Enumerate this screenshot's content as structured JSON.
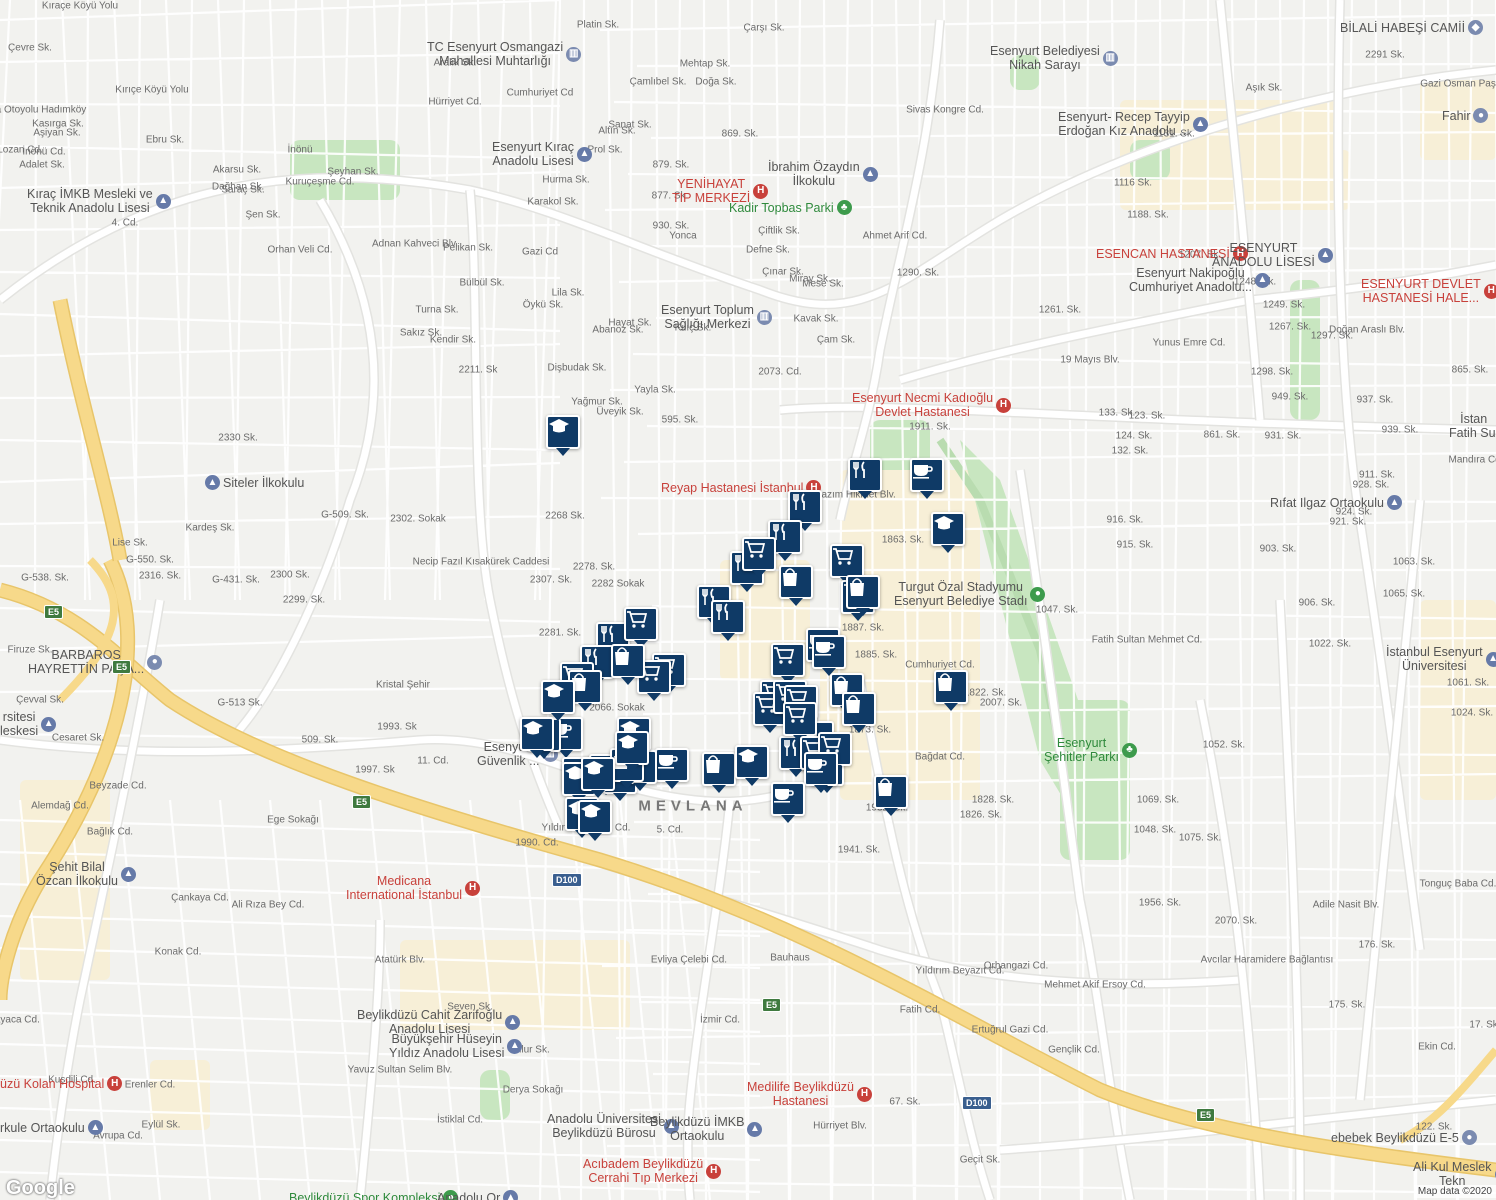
{
  "map": {
    "attribution": "Map data ©2020",
    "logo": "Google",
    "district_label": "MEVLANA",
    "colors": {
      "background": "#f2f2ef",
      "street": "#ffffff",
      "highway": "#f7d98a",
      "park": "#c8e6c0",
      "commercial": "#f7efd7",
      "pin": "#0f3a66",
      "hospital": "#c8413b",
      "school": "#667aa8",
      "park_label": "#2f8a3c"
    },
    "road_shields": [
      {
        "text": "E5",
        "type": "green"
      },
      {
        "text": "E5",
        "type": "green"
      },
      {
        "text": "E5",
        "type": "green"
      },
      {
        "text": "E5",
        "type": "green"
      },
      {
        "text": "E5",
        "type": "green"
      },
      {
        "text": "D100",
        "type": "blue"
      },
      {
        "text": "D100",
        "type": "blue"
      }
    ],
    "pois": [
      {
        "name": "TC Esenyurt Osmangazi\nMahallesi Muhtarlığı",
        "type": "gov",
        "icon": "government-icon"
      },
      {
        "name": "Esenyurt Belediyesi\nNikah Sarayı",
        "type": "gov",
        "icon": "government-icon"
      },
      {
        "name": "BİLALİ HABEŞİ CAMİİ",
        "type": "gov",
        "icon": "mosque-icon"
      },
      {
        "name": "Esenyurt Kıraç\nAnadolu Lisesi",
        "type": "school",
        "icon": "school-icon"
      },
      {
        "name": "Esenyurt- Recep Tayyip\nErdoğan Kız Anadolu ...",
        "type": "school",
        "icon": "school-icon"
      },
      {
        "name": "Kıraç İMKB Mesleki ve\nTeknik Anadolu Lisesi",
        "type": "school",
        "icon": "school-icon"
      },
      {
        "name": "YENİHAYAT\nTIP MERKEZİ",
        "type": "hospital",
        "icon": "hospital-icon"
      },
      {
        "name": "İbrahim Özaydın\nİlkokulu",
        "type": "school",
        "icon": "school-icon"
      },
      {
        "name": "Kadir Topbas Parki",
        "type": "park",
        "icon": "tree-icon"
      },
      {
        "name": "ESENCAN HASTANESİ",
        "type": "hospital",
        "icon": "hospital-icon"
      },
      {
        "name": "ESENYURT\nANADOLU LİSESİ",
        "type": "school",
        "icon": "school-icon"
      },
      {
        "name": "Esenyurt Nakipoğlu\nCumhuriyet Anadolu...",
        "type": "school",
        "icon": "school-icon"
      },
      {
        "name": "ESENYURT DEVLET\nHASTANESİ HALE...",
        "type": "hospital",
        "icon": "hospital-icon"
      },
      {
        "name": "Esenyurt Toplum\nSağlığı Merkezi",
        "type": "gov",
        "icon": "government-icon"
      },
      {
        "name": "Esenyurt Necmi Kadıoğlu\nDevlet Hastanesi",
        "type": "hospital",
        "icon": "hospital-icon"
      },
      {
        "name": "Reyap Hastanesi İstanbul",
        "type": "hospital",
        "icon": "hospital-icon"
      },
      {
        "name": "Rıfat Ilgaz Ortaokulu",
        "type": "school",
        "icon": "school-icon"
      },
      {
        "name": "İstan\nFatih Sul",
        "type": "school",
        "icon": "school-icon"
      },
      {
        "name": "Siteler İlkokulu",
        "type": "school",
        "icon": "school-icon"
      },
      {
        "name": "Turgut Özal Stadyumu\nEsenyurt Belediye Stadı",
        "type": "stadium",
        "icon": "stadium-icon"
      },
      {
        "name": "BARBAROS\nHAYRETTİN PAŞA...",
        "type": "gov",
        "icon": "place-icon"
      },
      {
        "name": "İstanbul Esenyurt\nÜniversitesi",
        "type": "school",
        "icon": "school-icon"
      },
      {
        "name": "Esenyurt\nŞehitler Parkı",
        "type": "park",
        "icon": "tree-icon"
      },
      {
        "name": "Esenyurt\nGüvenlik ...",
        "type": "gov",
        "icon": "government-icon"
      },
      {
        "name": "rsitesi\nleskesi",
        "type": "school",
        "icon": "school-icon"
      },
      {
        "name": "Medicana\nInternational İstanbul",
        "type": "hospital",
        "icon": "hospital-icon"
      },
      {
        "name": "Şehit Bilal\nÖzcan İlkokulu",
        "type": "school",
        "icon": "school-icon"
      },
      {
        "name": "Beylikdüzü Cahit Zarifoğlu\nAnadolu Lisesi",
        "type": "school",
        "icon": "school-icon"
      },
      {
        "name": "Büyükşehir Hüseyin\nYıldız Anadolu Lisesi",
        "type": "school",
        "icon": "school-icon"
      },
      {
        "name": "üzü Kolan Hospital",
        "type": "hospital",
        "icon": "hospital-icon"
      },
      {
        "name": "Medilife Beylikdüzü\nHastanesi",
        "type": "hospital",
        "icon": "hospital-icon"
      },
      {
        "name": "rkule Ortaokulu",
        "type": "school",
        "icon": "school-icon"
      },
      {
        "name": "Anadolu Üniversitesi\nBeylikdüzü Bürosu",
        "type": "school",
        "icon": "school-icon"
      },
      {
        "name": "Beylikdüzü İMKB\nOrtaokulu",
        "type": "school",
        "icon": "school-icon"
      },
      {
        "name": "Acıbadem Beylikdüzü\nCerrahi Tıp Merkezi",
        "type": "hospital",
        "icon": "hospital-icon"
      },
      {
        "name": "ebebek Beylikdüzü E-5",
        "type": "gov",
        "icon": "shop-icon"
      },
      {
        "name": "Ali Kul Meslek\nTekn",
        "type": "school",
        "icon": "school-icon"
      },
      {
        "name": "Fahir",
        "type": "gov",
        "icon": "place-icon"
      },
      {
        "name": "Beylikdüzü Spor Kompleksi",
        "type": "park",
        "icon": "sport-icon"
      },
      {
        "name": "Anadolu Or",
        "type": "school",
        "icon": "school-icon"
      }
    ],
    "pin_counts": {
      "restaurant": 10,
      "grocery": 16,
      "cafe": 12,
      "shopping": 11,
      "school": 12
    },
    "street_labels": [
      "Kıraçe Köyü Yolu",
      "Avrupa Otoyolu Hadımköy",
      "Çevre Sk.",
      "Kasırga Sk.",
      "Aşiyan Sk.",
      "İnönü Cd.",
      "Lozan Cd.",
      "Adalet Sk.",
      "Ebru Sk.",
      "Kırıçe Köyü Yolu",
      "İnönü",
      "Cumhuriyet Cd",
      "Hürriyet Cd.",
      "Aralık Sk.",
      "Mehtap Sk.",
      "Çamlıbel Sk.",
      "Doğa Sk.",
      "Sanat Sk.",
      "Kuruçeşme Cd.",
      "Dağhan Sk.",
      "Akarsu Sk.",
      "Saraç Sk.",
      "Şen Sk.",
      "Şeyhan Sk.",
      "Adnan Kahveci Blv.",
      "Orhan Veli Cd.",
      "4. Cd.",
      "Gazi Cd",
      "Pelikan Sk.",
      "Bülbül Sk.",
      "Turna Sk.",
      "Sakız Sk.",
      "Kendir Sk.",
      "Öykü Sk.",
      "Hayat Sk.",
      "Kılıç Sk.",
      "2211. Sk",
      "2073. Cd.",
      "Yağmur Sk.",
      "Üveyik Sk.",
      "595. Sk.",
      "Necip Fazıl Kısakürek Caddesi",
      "2330 Sk.",
      "2268 Sk.",
      "2278. Sk.",
      "2282 Sokak",
      "2307. Sk.",
      "2302. Sokak",
      "2281. Sk.",
      "2066. Sokak",
      "1993. Sk",
      "509. Sk.",
      "11. Cd.",
      "Beyzade Cd.",
      "1997. Sk",
      "Alemdağ Cd.",
      "Bağlık Cd.",
      "Ege Sokağı",
      "Yıldırım Beyazıt Cd.",
      "1990. Cd.",
      "5. Cd.",
      "Çankaya Cd.",
      "Konak Cd.",
      "Seven Sk.",
      "Evliya Çelebi Cd.",
      "İzmir Cd.",
      "Bauhaus",
      "Sayaca Cd.",
      "Erenler Cd.",
      "Eylül Sk.",
      "Billur Sk.",
      "Derya Sokağı",
      "İstiklal Cd.",
      "Hürriyet Blv.",
      "Geçit Sk.",
      "67. Sk.",
      "122. Sk.",
      "Ekin Cd.",
      "17. Sk.",
      "175. Sk.",
      "176. Sk.",
      "Yıldırım Beyazıt Cd.",
      "Orhangazi Cd.",
      "Fatih Cd.",
      "1828. Sk.",
      "Bağdat Cd.",
      "Cumhuriyet Cd.",
      "1047. Sk.",
      "Fatih Sultan Mehmet Cd.",
      "1048. Sk.",
      "Avcılar Haramidere Bağlantısı",
      "Adile Nasit Blv.",
      "Tonguç Baba Cd.",
      "911. Sk.",
      "Mandıra Cd.",
      "19 Mayıs Blv.",
      "Doğan Araslı Blv.",
      "Sivas Kongre Cd.",
      "Ahmet Arif Cd.",
      "Nazım Hikmet Blv.",
      "1911. Sk.",
      "1863. Sk.",
      "1887. Sk.",
      "1885. Sk.",
      "1873. Sk.",
      "1932. Sk.",
      "1941. Sk.",
      "1826. Sk.",
      "2007. Sk.",
      "1822. Sk.",
      "1052. Sk.",
      "1069. Sk.",
      "1075. Sk.",
      "2070. Sk.",
      "1956. Sk.",
      "Mehmet Akif Ersoy Cd.",
      "Gençlik Cd.",
      "Ertuğrul Gazi Cd.",
      "Atatürk Blv.",
      "Yavuz Sultan Selim Blv.",
      "Kuşdili Cd.",
      "Avrupa Cd.",
      "Firuze Sk.",
      "Cesaret Sk.",
      "Çevval Sk.",
      "Lise Sk.",
      "G-550. Sk.",
      "G-538. Sk.",
      "Kardeş Sk.",
      "G-431. Sk.",
      "G-513 Sk.",
      "G-509. Sk.",
      "2300 Sk.",
      "2299. Sk.",
      "2316. Sk.",
      "Kristal Şehir",
      "2291 Sk.",
      "Gazi Osman Paşa Cd.",
      "Aşık Sk.",
      "1131. Sk.",
      "1116 Sk.",
      "1188. Sk.",
      "1207. Sk.",
      "1290. Sk.",
      "1248. Sk.",
      "1249. Sk.",
      "1261. Sk.",
      "1267. Sk.",
      "1297. Sk.",
      "1298. Sk.",
      "949. Sk.",
      "937. Sk.",
      "931. Sk.",
      "939. Sk.",
      "928. Sk.",
      "924. Sk.",
      "921. Sk.",
      "903. Sk.",
      "916. Sk.",
      "915. Sk.",
      "906. Sk.",
      "1022. Sk.",
      "1024. Sk.",
      "1061. Sk.",
      "1063. Sk.",
      "1065. Sk.",
      "123. Sk.",
      "124. Sk.",
      "132. Sk.",
      "133. Sk.",
      "861. Sk.",
      "865. Sk.",
      "869. Sk.",
      "879. Sk.",
      "877. Sk.",
      "930. Sk.",
      "Yonca",
      "Çiftlik Sk.",
      "Defne Sk.",
      "Çınar Sk.",
      "Mese Sk.",
      "Miray Sk.",
      "Kavak Sk.",
      "Çam Sk.",
      "Dişbudak Sk.",
      "Yayla Sk.",
      "Hurma Sk.",
      "Karakol Sk.",
      "Lila Sk.",
      "Abanoz Sk.",
      "Prol Sk.",
      "Altın Sk.",
      "Platin Sk.",
      "Çarşı Sk.",
      "Yunus Emre Cd.",
      "Ali Rıza Bey Cd.",
      "Kaya Sk.",
      "Atlas Sk.",
      "Başak Sk.",
      "Eylül Sk.",
      "Kıraçe Köyü Yolu",
      "Urfalılar Cd.",
      "Derviş Eroğlu Cd."
    ]
  }
}
